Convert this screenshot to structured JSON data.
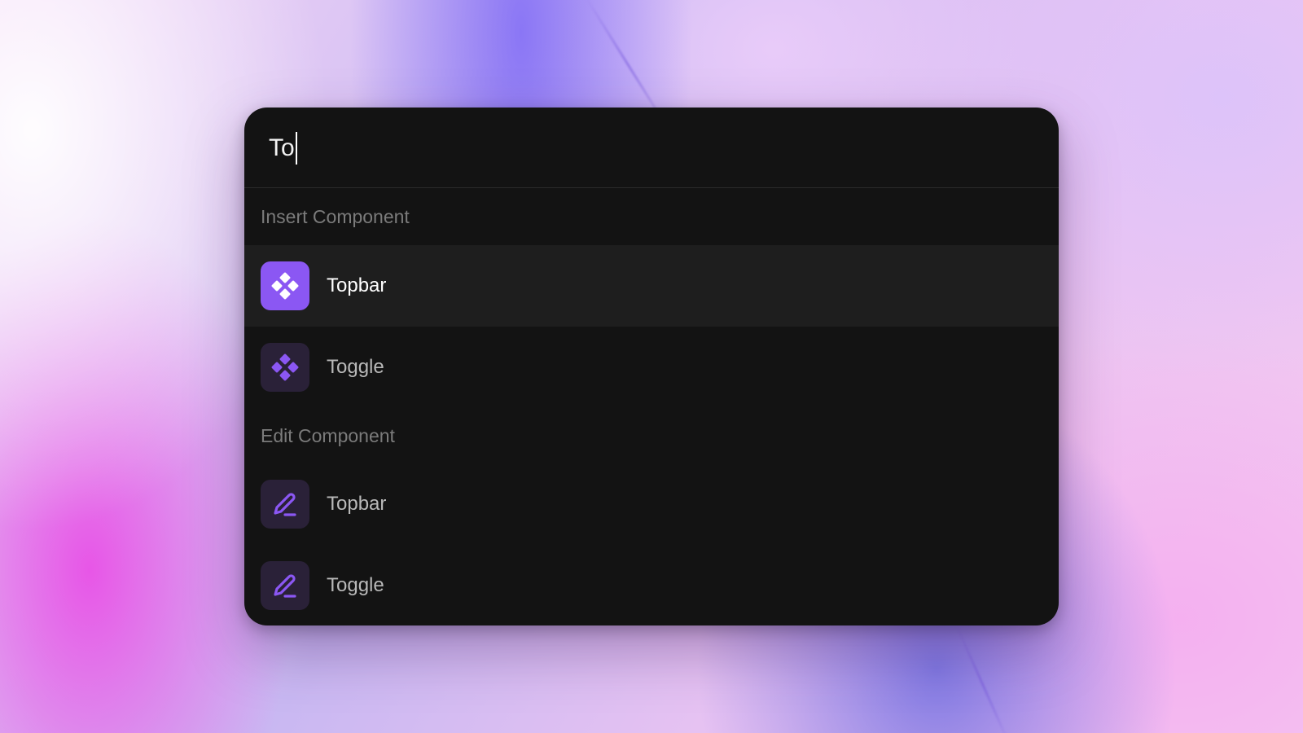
{
  "search": {
    "value": "To"
  },
  "sections": [
    {
      "label": "Insert Component",
      "items": [
        {
          "label": "Topbar",
          "icon": "component-icon",
          "selected": true
        },
        {
          "label": "Toggle",
          "icon": "component-icon",
          "selected": false
        }
      ]
    },
    {
      "label": "Edit Component",
      "items": [
        {
          "label": "Topbar",
          "icon": "pen-icon",
          "selected": false
        },
        {
          "label": "Toggle",
          "icon": "pen-icon",
          "selected": false
        }
      ]
    }
  ],
  "colors": {
    "accent": "#8b57f3",
    "panel": "#131313",
    "selected_row": "#1e1e1e",
    "muted_icon_bg": "#2a2138"
  }
}
